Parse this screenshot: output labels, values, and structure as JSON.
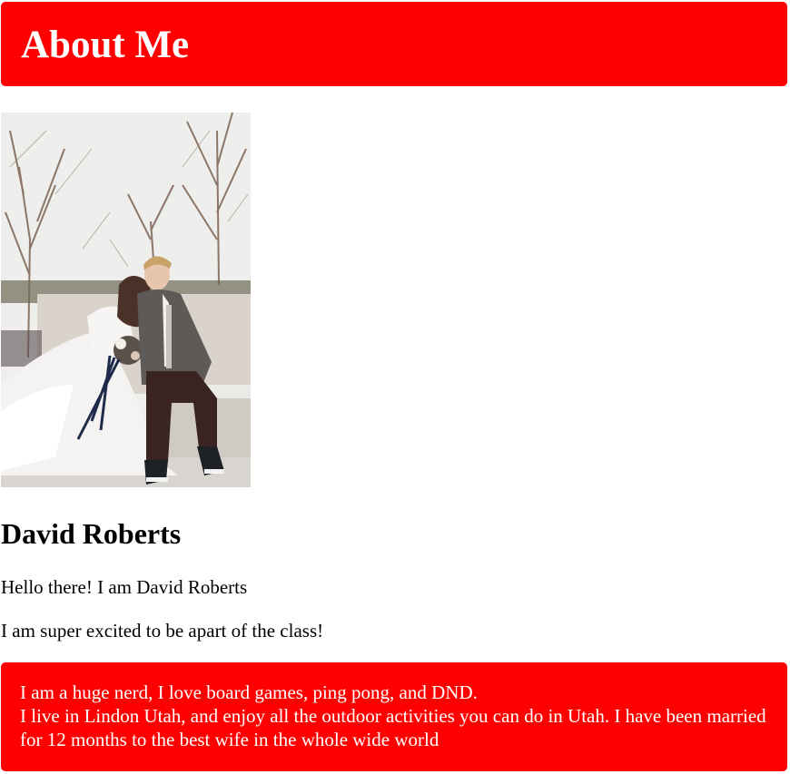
{
  "header": {
    "title": "About Me",
    "background": "#ff0000"
  },
  "photo": {
    "icon": "wedding-photo"
  },
  "profile": {
    "name": "David Roberts",
    "greeting": "Hello there! I am David Roberts",
    "excited": "I am super excited to be apart of the class!"
  },
  "footer": {
    "line1": "I am a huge nerd, I love board games, ping pong, and DND.",
    "line2": "I live in Lindon Utah, and enjoy all the outdoor activities you can do in Utah. I have been married for 12 months to the best wife in the whole wide world",
    "background": "#ff0000"
  }
}
